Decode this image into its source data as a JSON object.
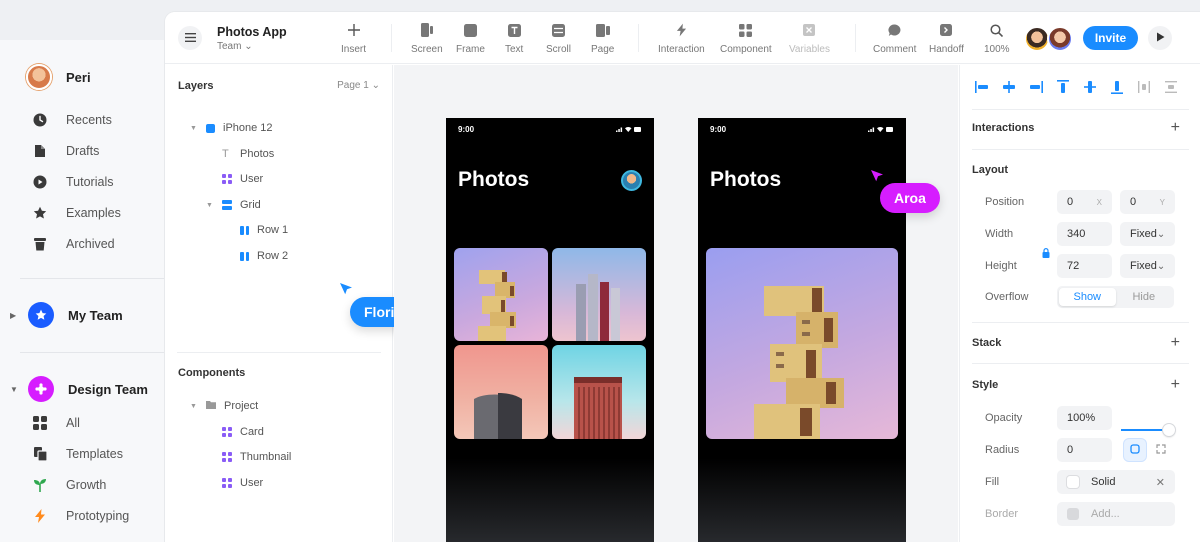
{
  "sidebar": {
    "user_name": "Peri",
    "nav": [
      {
        "label": "Recents",
        "icon": "clock-icon"
      },
      {
        "label": "Drafts",
        "icon": "file-icon"
      },
      {
        "label": "Tutorials",
        "icon": "play-circle-icon"
      },
      {
        "label": "Examples",
        "icon": "star-icon"
      },
      {
        "label": "Archived",
        "icon": "trash-icon"
      }
    ],
    "my_team": "My Team",
    "design_team": "Design Team",
    "team_items": [
      {
        "label": "All",
        "icon": "grid-icon"
      },
      {
        "label": "Templates",
        "icon": "template-icon"
      },
      {
        "label": "Growth",
        "icon": "sprout-icon"
      },
      {
        "label": "Prototyping",
        "icon": "bolt-icon"
      }
    ]
  },
  "toolbar": {
    "app_title": "Photos App",
    "app_sub": "Team",
    "tools": {
      "insert": "Insert",
      "screen": "Screen",
      "frame": "Frame",
      "text": "Text",
      "scroll": "Scroll",
      "page": "Page",
      "interaction": "Interaction",
      "component": "Component",
      "variables": "Variables",
      "comment": "Comment",
      "handoff": "Handoff",
      "zoom": "100%"
    },
    "invite": "Invite"
  },
  "layers": {
    "title": "Layers",
    "page": "Page 1",
    "items": [
      "iPhone 12",
      "Photos",
      "User",
      "Grid",
      "Row 1",
      "Row 2"
    ],
    "components_title": "Components",
    "components": [
      "Project",
      "Card",
      "Thumbnail",
      "User"
    ]
  },
  "cursors": {
    "floris": "Floris",
    "aroa": "Aroa",
    "floris_color": "#1a8cff",
    "aroa_color": "#d61dff"
  },
  "canvas": {
    "phone1": {
      "time": "9:00",
      "title": "Photos"
    },
    "phone2": {
      "time": "9:00",
      "title": "Photos"
    }
  },
  "props": {
    "interactions": "Interactions",
    "layout": "Layout",
    "position_label": "Position",
    "pos_x": "0",
    "pos_x_suffix": "X",
    "pos_y": "0",
    "pos_y_suffix": "Y",
    "width_label": "Width",
    "width": "340",
    "width_mode": "Fixed",
    "height_label": "Height",
    "height": "72",
    "height_mode": "Fixed",
    "overflow_label": "Overflow",
    "overflow_show": "Show",
    "overflow_hide": "Hide",
    "stack": "Stack",
    "style": "Style",
    "opacity_label": "Opacity",
    "opacity": "100%",
    "radius_label": "Radius",
    "radius": "0",
    "fill_label": "Fill",
    "fill_type": "Solid",
    "border_label": "Border",
    "border_placeholder": "Add..."
  }
}
